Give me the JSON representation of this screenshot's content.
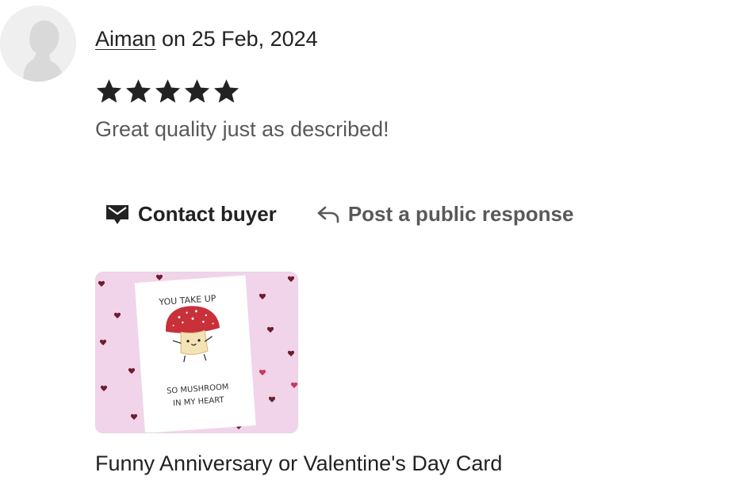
{
  "review": {
    "author": "Aiman",
    "date_text": " on 25 Feb, 2024",
    "rating": 5,
    "rating_max": 5,
    "text": "Great quality just as described!"
  },
  "actions": {
    "contact_label": "Contact buyer",
    "response_label": "Post a public response"
  },
  "product": {
    "title": "Funny Anniversary or Valentine's Day Card",
    "image_text_line1": "YOU TAKE UP",
    "image_text_line2": "SO MUSHROOM",
    "image_text_line3": "IN MY HEART"
  },
  "icons": {
    "avatar": "user-silhouette-icon",
    "star": "star-icon",
    "contact": "envelope-icon",
    "response": "reply-arrow-icon"
  },
  "colors": {
    "text_primary": "#222222",
    "text_secondary": "#595959",
    "card_background": "#f1d4ea",
    "mushroom_cap": "#c8303a"
  }
}
